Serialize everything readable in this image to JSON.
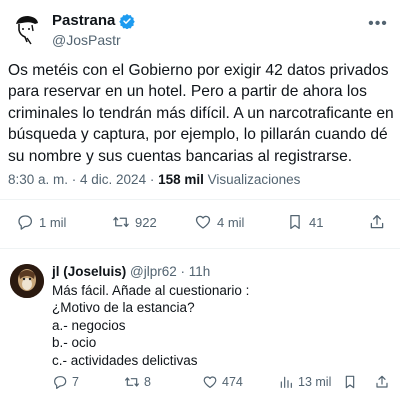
{
  "tweet": {
    "author_name": "Pastrana",
    "author_handle": "@JosPastr",
    "text": "Os metéis con el Gobierno por exigir 42 datos privados para reservar en un hotel. Pero a partir de ahora los criminales lo tendrán más difícil. A un narcotraficante en búsqueda y captura, por ejemplo, lo pillarán cuando dé su nombre y sus cuentas bancarias al registrarse.",
    "timestamp": "8:30 a. m. · 4 dic. 2024 · ",
    "views_count": "158 mil",
    "views_label": " Visualizaciones",
    "actions": {
      "replies": "1 mil",
      "retweets": "922",
      "likes": "4 mil",
      "bookmarks": "41"
    }
  },
  "reply": {
    "author_name": "jl (Joseluis)",
    "author_handle": "@jlpr62",
    "time": " · 11h",
    "lines": [
      "Más fácil. Añade al cuestionario :",
      "¿Motivo de la estancia?",
      "a.- negocios",
      "b.- ocio",
      "c.- actividades delictivas"
    ],
    "actions": {
      "replies": "7",
      "retweets": "8",
      "likes": "474",
      "views": "13 mil"
    }
  },
  "colors": {
    "text": "#0f1419",
    "secondary": "#536471",
    "verified": "#1d9bf0",
    "divider": "#eff3f4"
  }
}
